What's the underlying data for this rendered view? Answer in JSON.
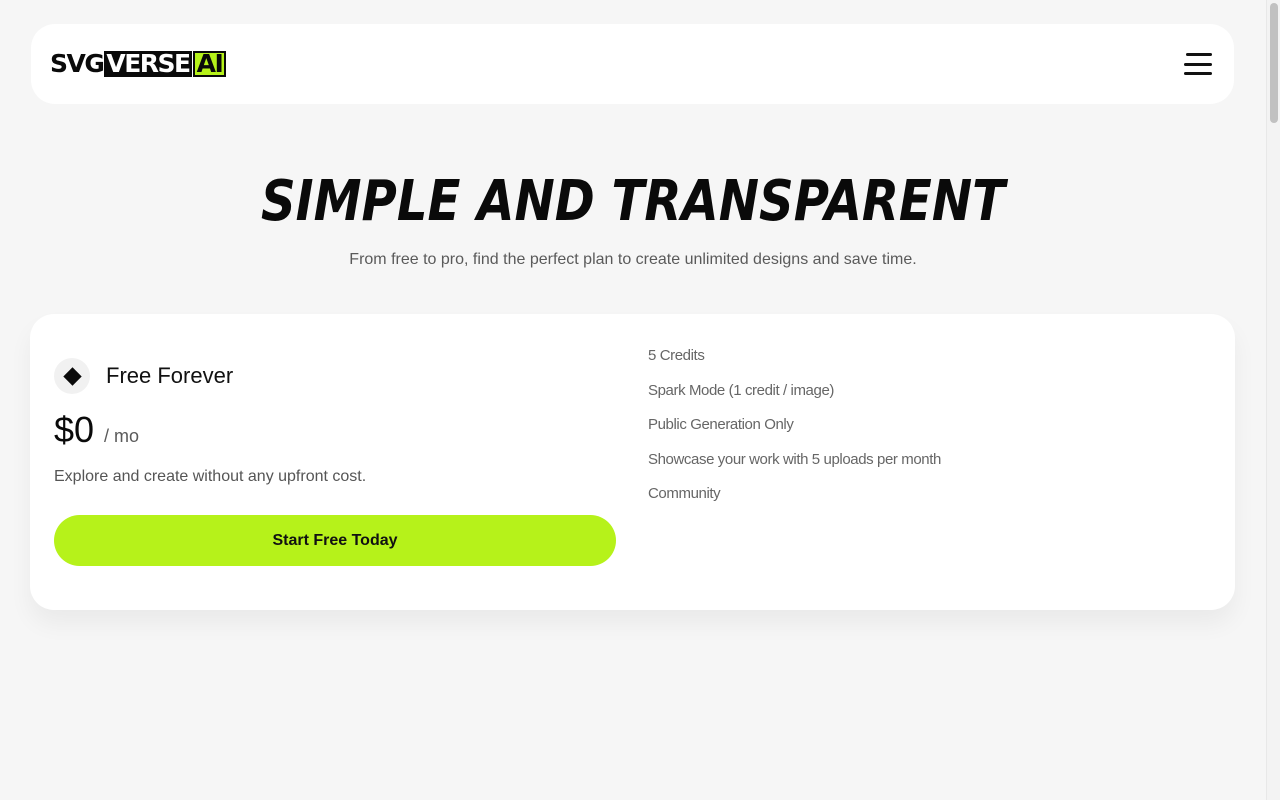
{
  "header": {
    "logo": {
      "part1": "SVG",
      "part2": "VERSE",
      "part3": "AI"
    },
    "menu_icon": "hamburger-menu-icon"
  },
  "hero": {
    "title": "SIMPLE AND TRANSPARENT",
    "subtitle": "From free to pro, find the perfect plan to create unlimited designs and save time."
  },
  "plan": {
    "icon": "diamond-icon",
    "name": "Free Forever",
    "price": "$0",
    "period": "/ mo",
    "description": "Explore and create without any upfront cost.",
    "cta_label": "Start Free Today",
    "features": [
      "5 Credits",
      "Spark Mode (1 credit / image)",
      "Public Generation Only",
      "Showcase your work with 5 uploads per month",
      "Community"
    ]
  },
  "colors": {
    "accent": "#b6f21a",
    "background": "#f6f6f6",
    "card": "#ffffff",
    "text": "#111111"
  }
}
